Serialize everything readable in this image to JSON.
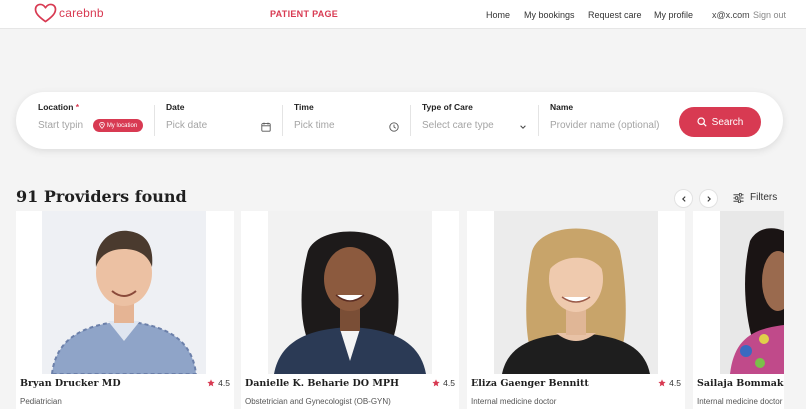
{
  "brand": {
    "name": "carebnb",
    "accent": "#d83a52"
  },
  "header": {
    "page_label": "PATIENT PAGE",
    "nav": [
      "Home",
      "My bookings",
      "Request care",
      "My profile"
    ],
    "user_email": "x@x.com",
    "signout": "Sign out"
  },
  "search": {
    "location": {
      "label": "Location",
      "required_mark": "*",
      "placeholder": "Start typin",
      "my_location_label": "My location",
      "icon": "pin-icon"
    },
    "date": {
      "label": "Date",
      "placeholder": "Pick date",
      "icon": "calendar-icon"
    },
    "time": {
      "label": "Time",
      "placeholder": "Pick time",
      "icon": "clock-icon"
    },
    "care_type": {
      "label": "Type of Care",
      "placeholder": "Select care type",
      "icon": "chevron-down-icon"
    },
    "name": {
      "label": "Name",
      "placeholder": "Provider name (optional)"
    },
    "button_label": "Search"
  },
  "results": {
    "count_text": "91 Providers found",
    "filters_label": "Filters",
    "prev_icon": "chevron-left-icon",
    "next_icon": "chevron-right-icon"
  },
  "providers": [
    {
      "name": "Bryan Drucker MD",
      "rating": "4.5",
      "specialty": "Pediatrician"
    },
    {
      "name": "Danielle K. Beharie DO MPH",
      "rating": "4.5",
      "specialty": "Obstetrician and Gynecologist (OB-GYN)"
    },
    {
      "name": "Eliza Gaenger Bennitt",
      "rating": "4.5",
      "specialty": "Internal medicine doctor"
    },
    {
      "name": "Sailaja Bommakanti",
      "rating": "",
      "specialty": "Internal medicine doctor"
    }
  ]
}
